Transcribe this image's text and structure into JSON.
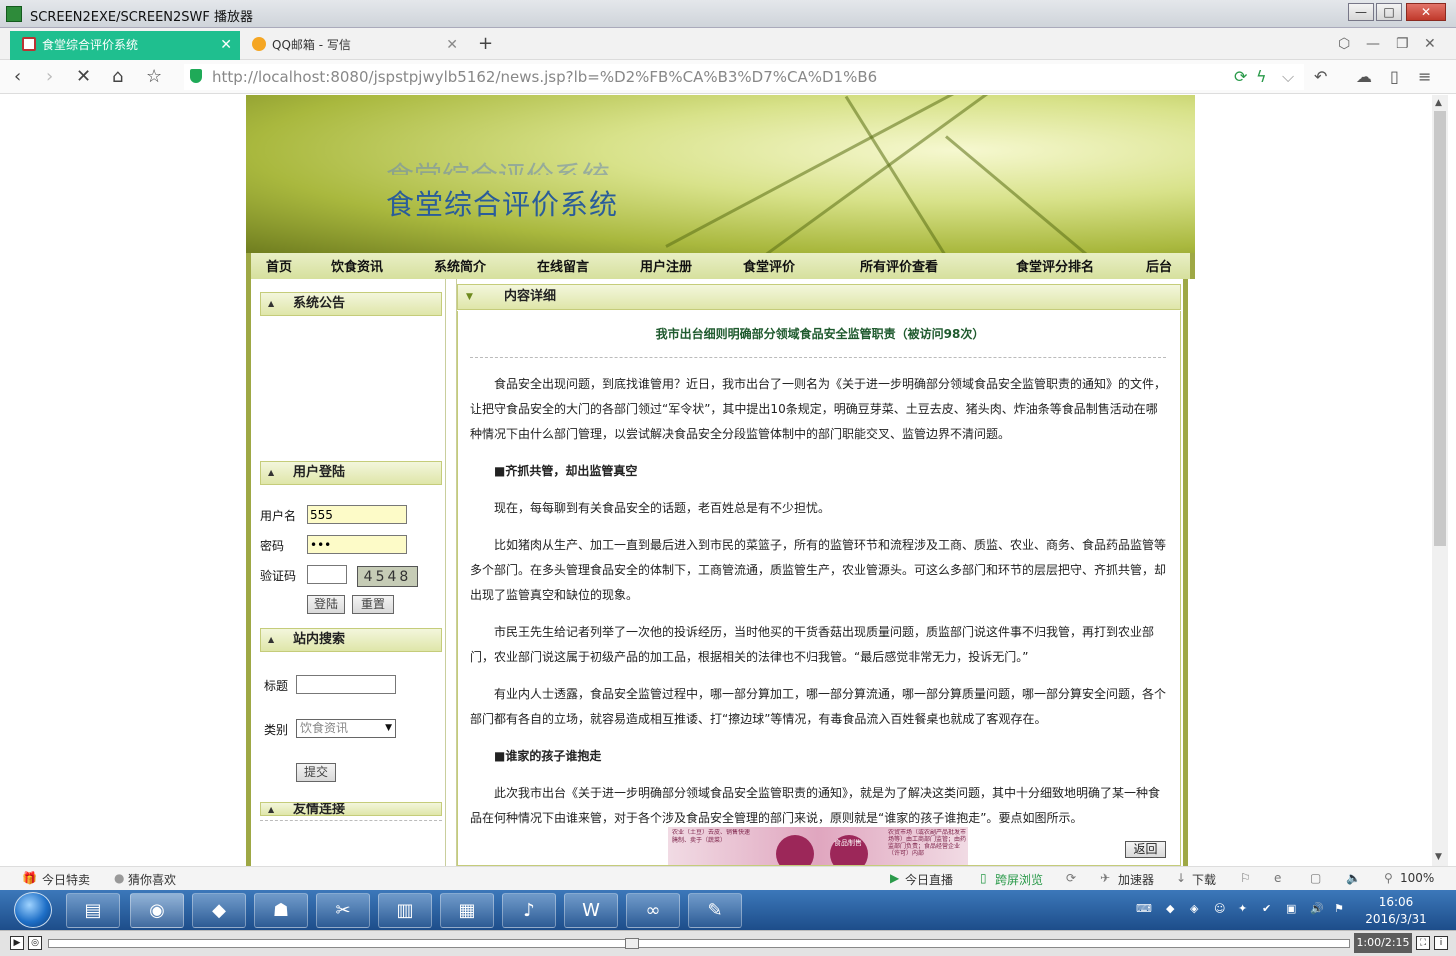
{
  "window": {
    "title": "SCREEN2EXE/SCREEN2SWF 播放器"
  },
  "browser": {
    "tabs": [
      {
        "label": "食堂综合评价系统"
      },
      {
        "label": "QQ邮箱 - 写信"
      }
    ],
    "url": "http://localhost:8080/jspstpjwylb5162/news.jsp?lb=%D2%FB%CA%B3%D7%CA%D1%B6"
  },
  "site": {
    "banner_title": "食堂综合评价系统",
    "menu": [
      "首页",
      "饮食资讯",
      "系统简介",
      "在线留言",
      "用户注册",
      "食堂评价",
      "所有评价查看",
      "食堂评分排名",
      "后台"
    ],
    "notice": {
      "heading": "系统公告"
    },
    "login": {
      "heading": "用户登陆",
      "username_label": "用户名",
      "username_value": "555",
      "password_label": "密码",
      "password_value": "•••",
      "captcha_label": "验证码",
      "captcha_code": "4548",
      "login_button": "登陆",
      "reset_button": "重置"
    },
    "search": {
      "heading": "站内搜索",
      "title_label": "标题",
      "category_label": "类别",
      "category_value": "饮食资讯",
      "submit_button": "提交"
    },
    "links": {
      "heading": "友情连接"
    }
  },
  "content": {
    "heading": "内容详细",
    "article_title": "我市出台细则明确部分领域食品安全监管职责（被访问98次）",
    "paragraphs": [
      "食品安全出现问题，到底找谁管用？近日，我市出台了一则名为《关于进一步明确部分领域食品安全监管职责的通知》的文件，让把守食品安全的大门的各部门领过“军令状”，其中提出10条规定，明确豆芽菜、土豆去皮、猪头肉、炸油条等食品制售活动在哪种情况下由什么部门管理，以尝试解决食品安全分段监管体制中的部门职能交叉、监管边界不清问题。",
      "■齐抓共管，却出监管真空",
      "现在，每每聊到有关食品安全的话题，老百姓总是有不少担忧。",
      "比如猪肉从生产、加工一直到最后进入到市民的菜篮子，所有的监管环节和流程涉及工商、质监、农业、商务、食品药品监管等多个部门。在多头管理食品安全的体制下，工商管流通，质监管生产，农业管源头。可这么多部门和环节的层层把守、齐抓共管，却出现了监管真空和缺位的现象。",
      "市民王先生给记者列举了一次他的投诉经历，当时他买的干货香菇出现质量问题，质监部门说这件事不归我管，再打到农业部门，农业部门说这属于初级产品的加工品，根据相关的法律也不归我管。“最后感觉非常无力，投诉无门。”",
      "有业内人士透露，食品安全监管过程中，哪一部分算加工，哪一部分算流通，哪一部分算质量问题，哪一部分算安全问题，各个部门都有各自的立场，就容易造成相互推诿、打“擦边球”等情况，有毒食品流入百姓餐桌也就成了客观存在。",
      "■谁家的孩子谁抱走",
      "此次我市出台《关于进一步明确部分领域食品安全监管职责的通知》，就是为了解决这类问题，其中十分细致地明确了某一种食品在何种情况下由谁来管，对于各个涉及食品安全管理的部门来说，原则就是“谁家的孩子谁抱走”。要点如图所示。"
    ],
    "figure_labels": [
      "农业（土豆）去皮、销售快速腌制、卖于（蔬菜）",
      "食品制售",
      "农贸市场（或农副产品批发市场等）由工商部门监管；由药监部门负责；食品经营企业（许可）内部"
    ],
    "back_button": "返回"
  },
  "statusbar": {
    "left": [
      "今日特卖",
      "猜你喜欢"
    ],
    "right": [
      "今日直播",
      "跨屏浏览",
      "加速器",
      "下载",
      "100%"
    ]
  },
  "taskbar": {
    "time": "16:06",
    "date": "2016/3/31"
  },
  "player": {
    "time": "1:00/2:15"
  }
}
